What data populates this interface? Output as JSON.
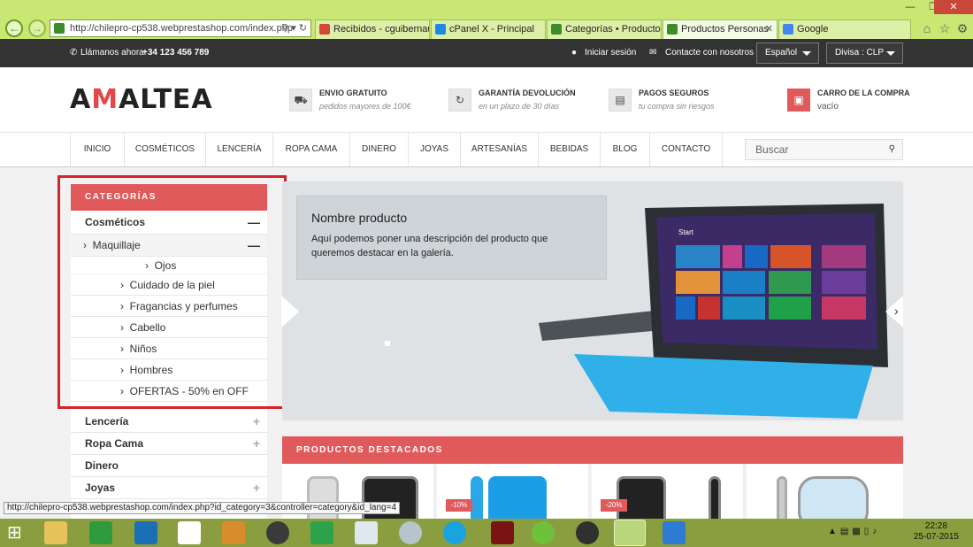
{
  "browser": {
    "url": "http://chilepro-cp538.webprestashop.com/index.php",
    "tabs": [
      {
        "label": "Recibidos - cguibernau...",
        "icon": "gmail-icon",
        "color": "#d44638"
      },
      {
        "label": "cPanel X - Principal",
        "icon": "ie-icon",
        "color": "#1e88e5"
      },
      {
        "label": "Categorías • Productos ...",
        "icon": "prestashop-icon",
        "color": "#3d8c2a"
      },
      {
        "label": "Productos Personas",
        "icon": "prestashop-icon",
        "color": "#3d8c2a"
      },
      {
        "label": "Google",
        "icon": "google-icon",
        "color": "#4285f4"
      }
    ],
    "status_url": "http://chilepro-cp538.webprestashop.com/index.php?id_category=3&controller=category&id_lang=4"
  },
  "topbar": {
    "call_prefix": "Llámanos ahora:",
    "phone": "+34 123 456 789",
    "login": "Iniciar sesión",
    "contact": "Contacte con nosotros",
    "language": "Español",
    "currency": "Divisa : CLP"
  },
  "header": {
    "logo_a": "A",
    "logo_m": "M",
    "logo_rest": "ALTEA",
    "features": [
      {
        "title": "ENVIO GRATUITO",
        "sub": "pedidos mayores de 100€",
        "icon": "truck-icon"
      },
      {
        "title": "GARANTÍA DEVOLUCIÓN",
        "sub": "en un plazo de 30 días",
        "icon": "refresh-icon"
      },
      {
        "title": "PAGOS SEGUROS",
        "sub": "tu compra sin riesgos",
        "icon": "credit-card-icon"
      }
    ],
    "cart_title": "CARRO DE LA COMPRA",
    "cart_status": "vacío"
  },
  "nav": {
    "items": [
      "INICIO",
      "COSMÉTICOS",
      "LENCERÍA",
      "ROPA CAMA",
      "DINERO",
      "JOYAS",
      "ARTESANÍAS",
      "BEBIDAS",
      "BLOG",
      "CONTACTO"
    ],
    "search_placeholder": "Buscar"
  },
  "categories": {
    "title": "CATEGORÍAS",
    "cosmeticos": "Cosméticos",
    "maquillaje": "Maquillaje",
    "ojos": "Ojos",
    "subitems": [
      "Cuidado de la piel",
      "Fragancias y perfumes",
      "Cabello",
      "Niños",
      "Hombres",
      "OFERTAS - 50% en OFF"
    ],
    "others": [
      "Lencería",
      "Ropa Cama",
      "Dinero",
      "Joyas"
    ]
  },
  "slider": {
    "product_name": "Nombre producto",
    "product_desc": "Aquí podemos poner una descripción del producto que queremos destacar en la galería.",
    "tablet_start": "Start"
  },
  "featured": {
    "title": "PRODUCTOS DESTACADOS",
    "badges": [
      "-10%",
      "-20%"
    ]
  },
  "clock": {
    "time": "22:28",
    "date": "25-07-2015"
  }
}
